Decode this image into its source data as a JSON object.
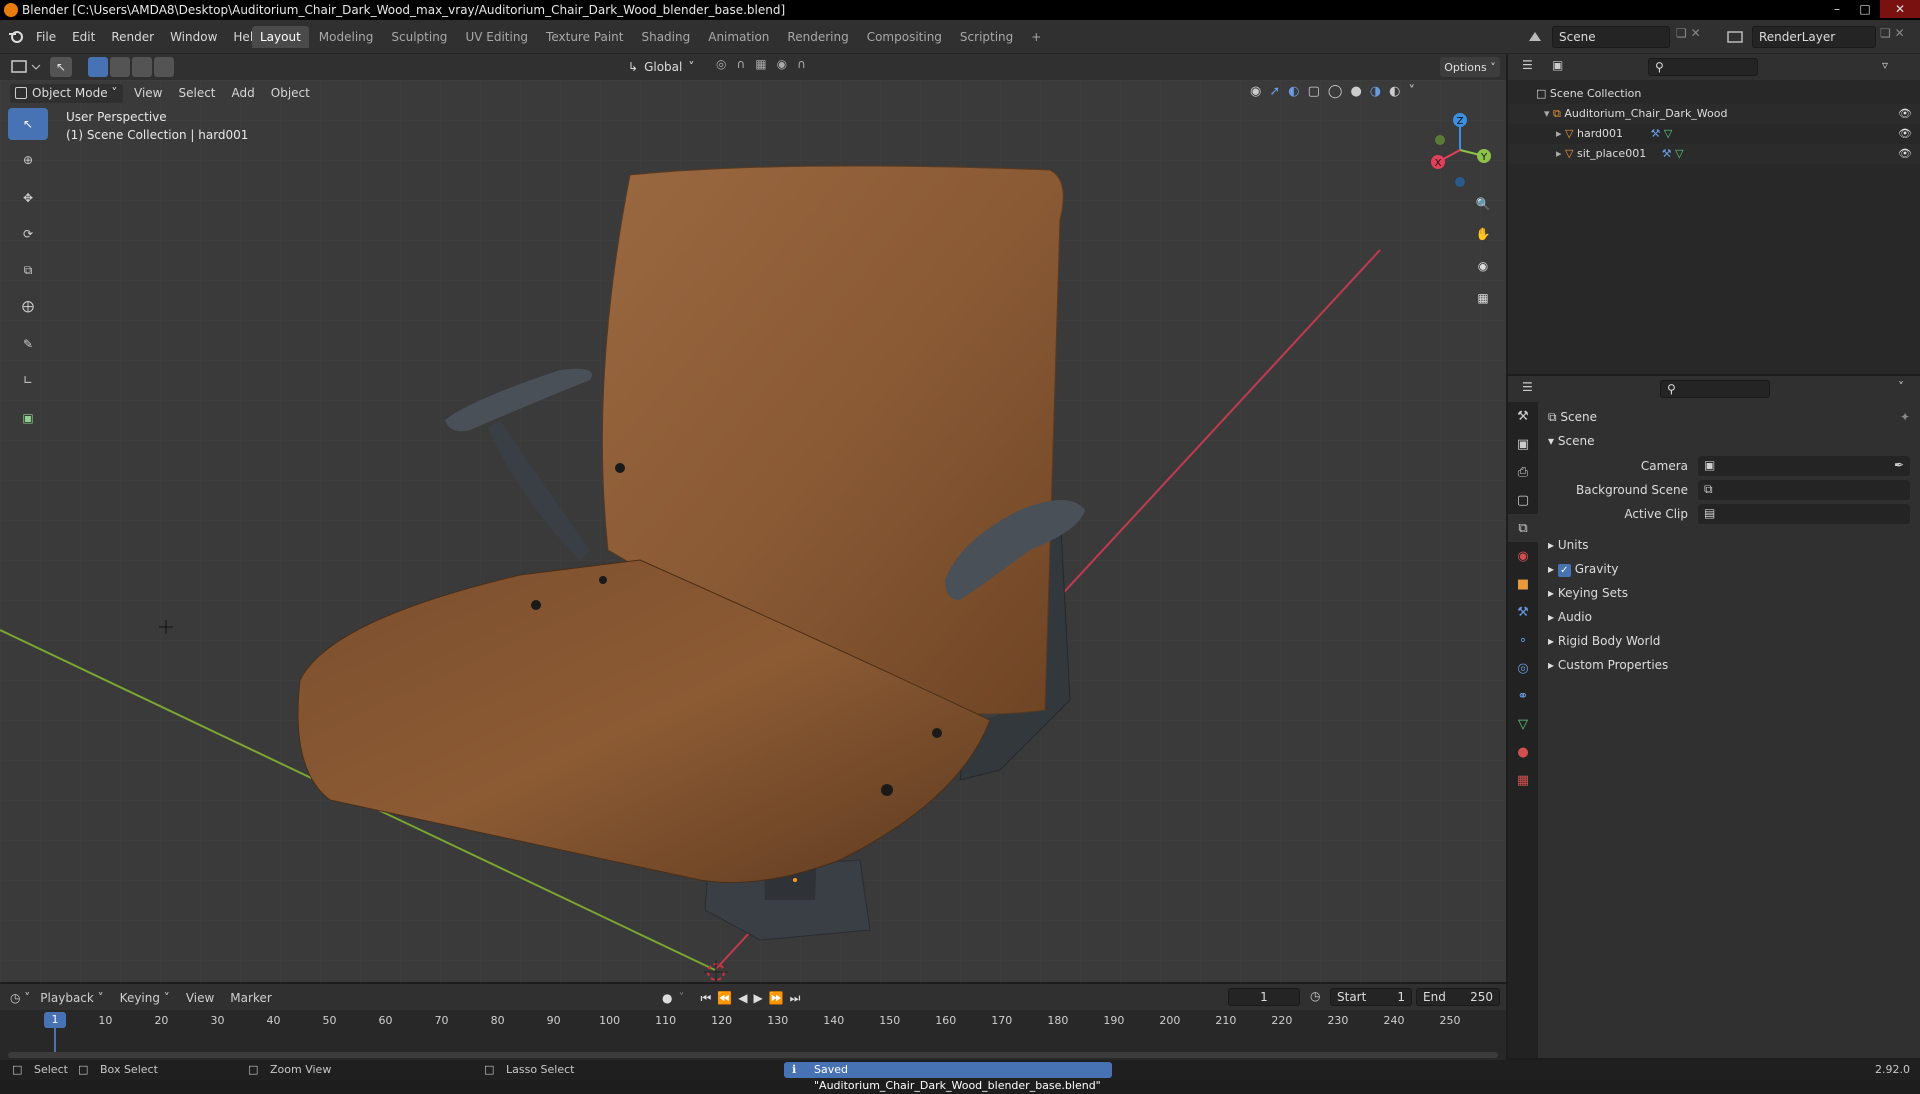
{
  "window": {
    "title": "Blender [C:\\Users\\AMDA8\\Desktop\\Auditorium_Chair_Dark_Wood_max_vray/Auditorium_Chair_Dark_Wood_blender_base.blend]"
  },
  "menubar": [
    "File",
    "Edit",
    "Render",
    "Window",
    "Help"
  ],
  "workspaces": [
    "Layout",
    "Modeling",
    "Sculpting",
    "UV Editing",
    "Texture Paint",
    "Shading",
    "Animation",
    "Rendering",
    "Compositing",
    "Scripting"
  ],
  "active_workspace": "Layout",
  "scene_selector": "Scene",
  "view_layer_selector": "RenderLayer",
  "header": {
    "orientation": "Global",
    "options_label": "Options"
  },
  "viewport": {
    "mode": "Object Mode",
    "menu": [
      "View",
      "Select",
      "Add",
      "Object"
    ],
    "perspective_label": "User Perspective",
    "collection_label": "(1) Scene Collection | hard001",
    "gizmo_axes": [
      "X",
      "Y",
      "Z"
    ]
  },
  "outliner": {
    "root": "Scene Collection",
    "items": [
      {
        "label": "Auditorium_Chair_Dark_Wood",
        "level": 1
      },
      {
        "label": "hard001",
        "level": 2
      },
      {
        "label": "sit_place001",
        "level": 2
      }
    ]
  },
  "properties": {
    "context": "Scene",
    "panel_title": "Scene",
    "fields": [
      {
        "label": "Camera",
        "value": ""
      },
      {
        "label": "Background Scene",
        "value": ""
      },
      {
        "label": "Active Clip",
        "value": ""
      }
    ],
    "sections": [
      "Units",
      "Gravity",
      "Keying Sets",
      "Audio",
      "Rigid Body World",
      "Custom Properties"
    ],
    "gravity_checked": true
  },
  "timeline": {
    "menu": [
      "Playback",
      "Keying",
      "View",
      "Marker"
    ],
    "current_frame": "1",
    "start_label": "Start",
    "start_value": "1",
    "end_label": "End",
    "end_value": "250",
    "ticks": [
      "10",
      "20",
      "30",
      "40",
      "50",
      "60",
      "70",
      "80",
      "90",
      "100",
      "110",
      "120",
      "130",
      "140",
      "150",
      "160",
      "170",
      "180",
      "190",
      "200",
      "210",
      "220",
      "230",
      "240",
      "250"
    ],
    "playhead_frame": "1"
  },
  "statusbar": {
    "select": "Select",
    "box_select": "Box Select",
    "zoom_view": "Zoom View",
    "lasso_select": "Lasso Select",
    "message": "Saved \"Auditorium_Chair_Dark_Wood_blender_base.blend\"",
    "version": "2.92.0"
  },
  "colors": {
    "accent": "#4772b3",
    "x_axis": "#e0405a",
    "y_axis": "#8bc34a",
    "z_axis": "#3a8fe0",
    "wood": "#8a5a35"
  }
}
